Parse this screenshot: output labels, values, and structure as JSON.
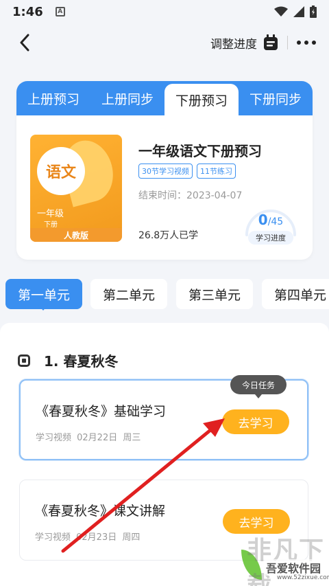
{
  "status_bar": {
    "time": "1:46",
    "notification_letter": "A"
  },
  "header": {
    "adjust_label": "调整进度"
  },
  "book_tabs": [
    {
      "label": "上册预习",
      "active": false
    },
    {
      "label": "上册同步",
      "active": false
    },
    {
      "label": "下册预习",
      "active": true
    },
    {
      "label": "下册同步",
      "active": false
    }
  ],
  "book": {
    "cover_title": "语文",
    "cover_grade": "一年级",
    "cover_volume": "下册",
    "cover_edition": "人教版",
    "title": "一年级语文下册预习",
    "tags": [
      "30节学习视频",
      "11节练习"
    ],
    "end_time": "结束时间：2023-04-07",
    "learners": "26.8万人已学",
    "progress": {
      "done": "0",
      "total": "/45",
      "label": "学习进度",
      "fraction": 0
    }
  },
  "units": [
    {
      "label": "第一单元",
      "active": true
    },
    {
      "label": "第二单元",
      "active": false
    },
    {
      "label": "第三单元",
      "active": false
    },
    {
      "label": "第四单元",
      "active": false
    }
  ],
  "section": {
    "title": "1. 春夏秋冬"
  },
  "lessons": [
    {
      "title": "《春夏秋冬》基础学习",
      "meta": "学习视频 02月22日 周三",
      "button": "去学习",
      "tip": "今日任务"
    },
    {
      "title": "《春夏秋冬》课文讲解",
      "meta": "学习视频 02月23日 周四",
      "button": "去学习"
    }
  ],
  "watermark": {
    "big": "非凡下载",
    "name": "吾爱软件园",
    "url": "www.52zixue.com"
  },
  "colors": {
    "accent": "#3a8ff0",
    "button": "#ffb21e",
    "arrow": "#e02020"
  }
}
